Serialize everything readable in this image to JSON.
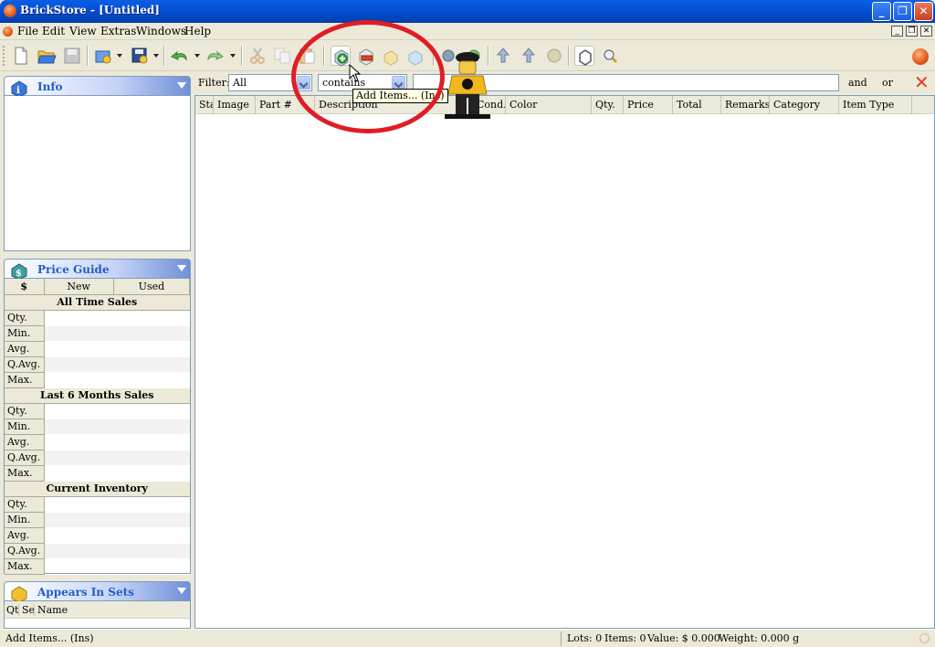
{
  "window": {
    "title": "BrickStore - [Untitled]"
  },
  "menu": [
    "File",
    "Edit",
    "View",
    "Extras",
    "Windows",
    "Help"
  ],
  "filter": {
    "label": "Filter:",
    "field_value": "All",
    "op_value": "contains",
    "text_value": "",
    "and_label": "and",
    "or_label": "or"
  },
  "columns": [
    "Status",
    "Image",
    "Part #",
    "Description",
    "Cond.",
    "Color",
    "Qty.",
    "Price",
    "Total",
    "Remarks",
    "Category",
    "Item Type"
  ],
  "tooltip": "Add Items... (Ins)",
  "info_panel": {
    "title": "Info"
  },
  "price_guide": {
    "title": "Price Guide",
    "currency": "$",
    "new_label": "New",
    "used_label": "Used",
    "sections": [
      {
        "title": "All Time Sales",
        "rows": [
          "Qty.",
          "Min.",
          "Avg.",
          "Q.Avg.",
          "Max."
        ]
      },
      {
        "title": "Last 6 Months Sales",
        "rows": [
          "Qty.",
          "Min.",
          "Avg.",
          "Q.Avg.",
          "Max."
        ]
      },
      {
        "title": "Current Inventory",
        "rows": [
          "Qty.",
          "Min.",
          "Avg.",
          "Q.Avg.",
          "Max."
        ]
      }
    ]
  },
  "appears_in_sets": {
    "title": "Appears In Sets",
    "col_qty": "Qty",
    "col_set": "Set",
    "col_name": "Name"
  },
  "status": {
    "message": "Add Items... (Ins)",
    "lots": "Lots: 0",
    "items": "Items: 0",
    "value": "Value: $ 0.000",
    "weight": "Weight: 0.000 g"
  },
  "colors": {
    "accent": "#215dc6",
    "annotation": "#e01d25"
  }
}
